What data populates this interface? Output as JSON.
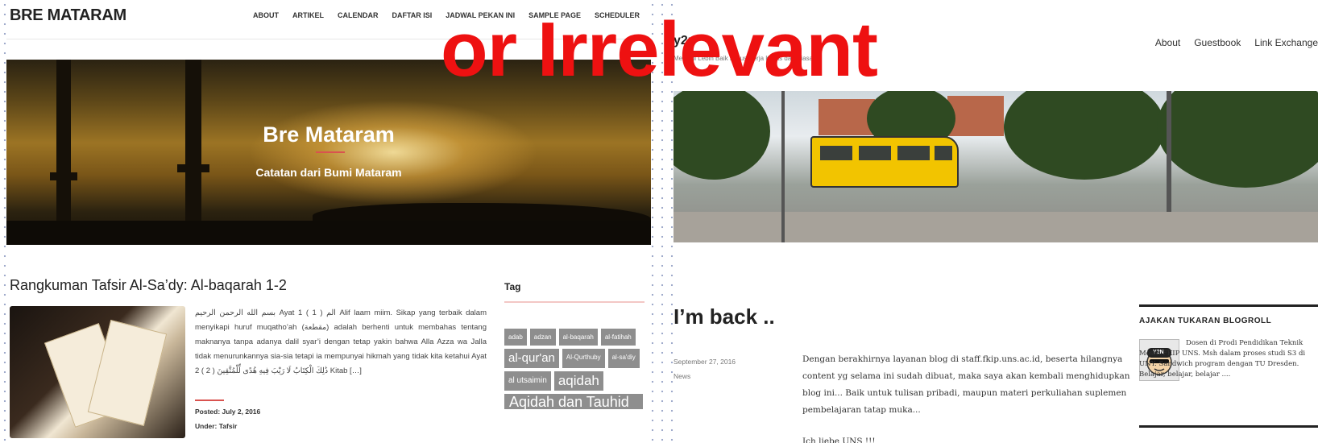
{
  "left": {
    "brand": "BRE MATARAM",
    "nav": [
      "ABOUT",
      "ARTIKEL",
      "CALENDAR",
      "DAFTAR ISI",
      "JADWAL PEKAN INI",
      "SAMPLE PAGE",
      "SCHEDULER"
    ],
    "hero_title": "Bre Mataram",
    "hero_subtitle": "Catatan dari Bumi Mataram",
    "post_title": "Rangkuman Tafsir Al-Sa’dy: Al-baqarah 1-2",
    "excerpt": "بسم الله الرحمن الرحيم Ayat 1 ( 1 ) الم Alif laam miim. Sikap yang terbaik dalam menyikapi huruf muqatho’ah (مقطعة) adalah berhenti untuk membahas tentang maknanya tanpa adanya dalil syar’i dengan tetap yakin bahwa Alla Azza wa Jalla tidak menurunkannya sia-sia tetapi ia mempunyai hikmah yang tidak kita ketahui Ayat 2 ( 2 ) ذَٰلِكَ الْكِتَابُ لَا رَيْبَ فِيهِ هُدًى لِّلْمُتَّقِينَ Kitab […]",
    "posted": "Posted: July 2, 2016",
    "under": "Under: Tafsir",
    "tag_heading": "Tag",
    "tags": [
      "adab",
      "adzan",
      "al-baqarah",
      "al-fatihah",
      "al-qur'an",
      "Al-Qurthuby",
      "al-sa'diy",
      "al utsaimin",
      "aqidah",
      "Aqidah dan Tauhid"
    ]
  },
  "right": {
    "site_title": "y2n",
    "site_desc": "Menjadi Lebih Baik Harus Kerja Keras dari Biasa",
    "nav": [
      "About",
      "Guestbook",
      "Link Exchange"
    ],
    "post_title": "I’m back ..",
    "date": "September 27, 2016",
    "category": "News",
    "body1": "Dengan berakhirnya layanan blog di staff.fkip.uns.ac.id, beserta hilangnya content yg selama ini sudah dibuat, maka saya akan kembali menghidupkan blog ini...  Baik untuk tulisan pribadi, maupun materi perkuliahan suplemen pembelajaran tatap muka...",
    "body2": "Ich liebe UNS !!!",
    "side_heading": "AJAKAN TUKARAN BLOGROLL",
    "side_text": "Dosen di Prodi Pendidikan Teknik Mesin FKIP UNS. Msh dalam proses studi S3 di UNY. Sandwich program dengan TU Dresden. Belajar, belajar, belajar ....",
    "avatar_label": "Y2N"
  },
  "overlay_text": "or Irrelevant",
  "colors": {
    "overlay": "#ee1111",
    "accent": "#d9534f",
    "tag": "#8e8e8e",
    "tram": "#f2c400"
  }
}
